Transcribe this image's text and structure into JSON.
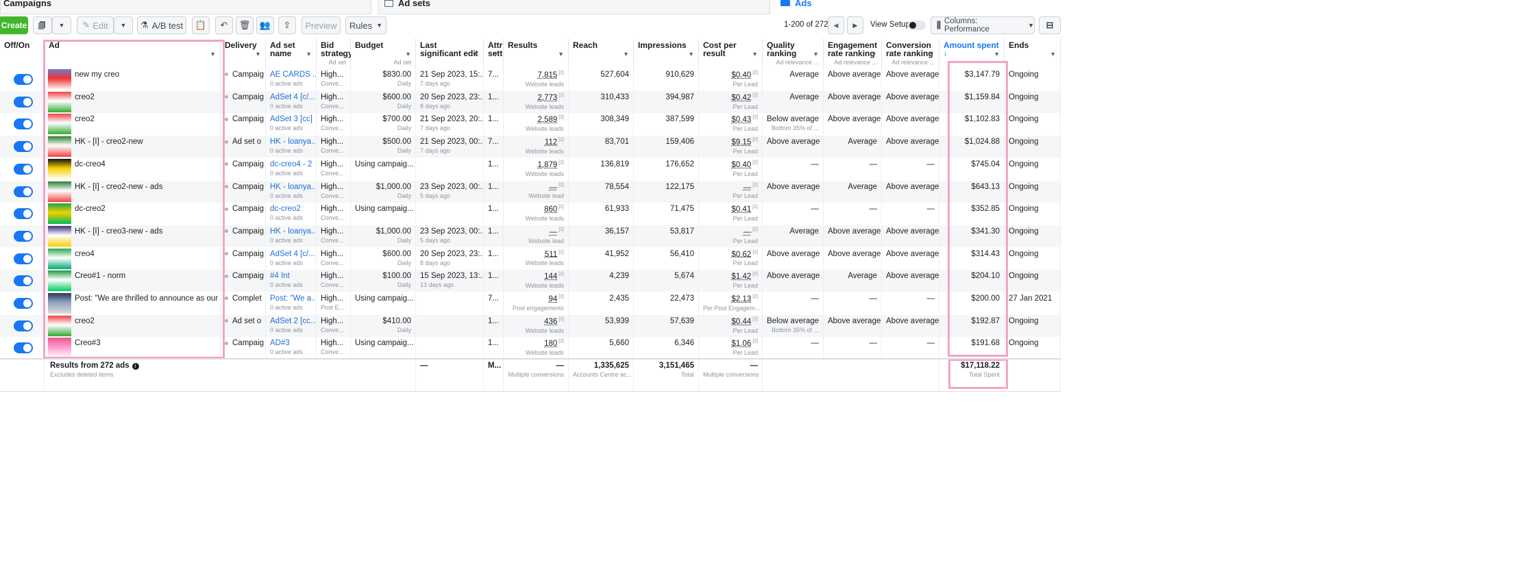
{
  "tabs": {
    "campaigns": "Campaigns",
    "adsets": "Ad sets",
    "ads": "Ads"
  },
  "toolbar": {
    "create": "Create",
    "edit": "Edit",
    "ab_test": "A/B test",
    "preview": "Preview",
    "rules": "Rules",
    "pagination": "1-200 of 272",
    "view_setup": "View Setup",
    "columns": "Columns: Performance"
  },
  "headers": {
    "offon": "Off/On",
    "ad": "Ad",
    "delivery": "Delivery",
    "adset_name": "Ad set name",
    "bid": "Bid strategy",
    "bid_sub": "Ad set",
    "budget": "Budget",
    "budget_sub": "Ad set",
    "last_edit": "Last significant edit",
    "attr": "Attr sett",
    "results": "Results",
    "reach": "Reach",
    "impressions": "Impressions",
    "cpr": "Cost per result",
    "quality": "Quality ranking",
    "quality_sub": "Ad relevance ...",
    "engagement": "Engagement rate ranking",
    "engagement_sub": "Ad relevance ...",
    "conversion": "Conversion rate ranking",
    "conversion_sub": "Ad relevance ...",
    "amount": "Amount spent",
    "amount_sort": "↓",
    "ends": "Ends"
  },
  "rows": [
    {
      "ad": "new my creo",
      "delivery": "Campaig",
      "adset": "AE CARDS ...",
      "adset_sub": "0 active ads",
      "bid": "High...",
      "bid_sub": "Conve...",
      "budget": "$830.00",
      "budget_sub": "Daily",
      "edit": "21 Sep 2023, 15:...",
      "edit_sub": "7 days ago",
      "attr": "7...",
      "results": "7,815",
      "results_sub": "Website leads",
      "reach": "527,604",
      "impr": "910,629",
      "cpr": "$0.40",
      "cpr_sub": "Per Lead",
      "quality": "Average",
      "quality_sub": "",
      "eng": "Above average",
      "conv": "Above average",
      "amount": "$3,147.79",
      "ends": "Ongoing",
      "thumb": [
        "#6b7fc7",
        "#e33",
        "#fff"
      ]
    },
    {
      "ad": "creo2",
      "delivery": "Campaig",
      "adset": "AdSet 4 [c/...",
      "adset_sub": "0 active ads",
      "bid": "High...",
      "bid_sub": "Conve...",
      "budget": "$600.00",
      "budget_sub": "Daily",
      "edit": "20 Sep 2023, 23:...",
      "edit_sub": "8 days ago",
      "attr": "1...",
      "results": "2,773",
      "results_sub": "Website leads",
      "reach": "310,433",
      "impr": "394,987",
      "cpr": "$0.42",
      "cpr_sub": "Per Lead",
      "quality": "Average",
      "quality_sub": "",
      "eng": "Above average",
      "conv": "Above average",
      "amount": "$1,159.84",
      "ends": "Ongoing",
      "thumb": [
        "#e44",
        "#fff",
        "#3a3"
      ]
    },
    {
      "ad": "creo2",
      "delivery": "Campaig",
      "adset": "AdSet 3 [cc]",
      "adset_sub": "0 active ads",
      "bid": "High...",
      "bid_sub": "Conve...",
      "budget": "$700.00",
      "budget_sub": "Daily",
      "edit": "21 Sep 2023, 20:...",
      "edit_sub": "7 days ago",
      "attr": "1...",
      "results": "2,589",
      "results_sub": "Website leads",
      "reach": "308,349",
      "impr": "387,599",
      "cpr": "$0.43",
      "cpr_sub": "Per Lead",
      "quality": "Below average",
      "quality_sub": "Bottom 35% of ...",
      "eng": "Above average",
      "conv": "Above average",
      "amount": "$1,102.83",
      "ends": "Ongoing",
      "thumb": [
        "#e44",
        "#fff",
        "#3a3"
      ]
    },
    {
      "ad": "HK - [I] - creo2-new",
      "delivery": "Ad set o",
      "adset": "HK - loanya...",
      "adset_sub": "0 active ads",
      "bid": "High...",
      "bid_sub": "Conve...",
      "budget": "$500.00",
      "budget_sub": "Daily",
      "edit": "21 Sep 2023, 00:...",
      "edit_sub": "7 days ago",
      "attr": "7...",
      "results": "112",
      "results_sub": "Website leads",
      "reach": "83,701",
      "impr": "159,406",
      "cpr": "$9.15",
      "cpr_sub": "Per Lead",
      "quality": "Above average",
      "quality_sub": "",
      "eng": "Average",
      "conv": "Above average",
      "amount": "$1,024.88",
      "ends": "Ongoing",
      "thumb": [
        "#2e7d32",
        "#fff",
        "#e44"
      ]
    },
    {
      "ad": "dc-creo4",
      "delivery": "Campaig",
      "adset": "dc-creo4 - 2",
      "adset_sub": "0 active ads",
      "bid": "High...",
      "bid_sub": "Conve...",
      "budget": "Using campaig...",
      "budget_sub": "",
      "edit": "",
      "edit_sub": "",
      "attr": "1...",
      "results": "1,879",
      "results_sub": "Website leads",
      "reach": "136,819",
      "impr": "176,652",
      "cpr": "$0.40",
      "cpr_sub": "Per Lead",
      "quality": "—",
      "quality_sub": "",
      "eng": "—",
      "conv": "—",
      "amount": "$745.04",
      "ends": "Ongoing",
      "thumb": [
        "#111",
        "#f5d000",
        "#fff"
      ]
    },
    {
      "ad": "HK - [I] - creo2-new - ads",
      "delivery": "Campaig",
      "adset": "HK - loanya...",
      "adset_sub": "0 active ads",
      "bid": "High...",
      "bid_sub": "Conve...",
      "budget": "$1,000.00",
      "budget_sub": "Daily",
      "edit": "23 Sep 2023, 00:...",
      "edit_sub": "5 days ago",
      "attr": "1...",
      "results": "—",
      "results_sub": "Website lead",
      "reach": "78,554",
      "impr": "122,175",
      "cpr": "—",
      "cpr_sub": "Per Lead",
      "quality": "Above average",
      "quality_sub": "",
      "eng": "Average",
      "conv": "Above average",
      "amount": "$643.13",
      "ends": "Ongoing",
      "thumb": [
        "#2e7d32",
        "#fff",
        "#e44"
      ]
    },
    {
      "ad": "dc-creo2",
      "delivery": "Campaig",
      "adset": "dc-creo2",
      "adset_sub": "0 active ads",
      "bid": "High...",
      "bid_sub": "Conve...",
      "budget": "Using campaig...",
      "budget_sub": "",
      "edit": "",
      "edit_sub": "",
      "attr": "1...",
      "results": "860",
      "results_sub": "Website leads",
      "reach": "61,933",
      "impr": "71,475",
      "cpr": "$0.41",
      "cpr_sub": "Per Lead",
      "quality": "—",
      "quality_sub": "",
      "eng": "—",
      "conv": "—",
      "amount": "$352.85",
      "ends": "Ongoing",
      "thumb": [
        "#1fa44a",
        "#f5d000",
        "#0b5"
      ]
    },
    {
      "ad": "HK - [I] - creo3-new - ads",
      "delivery": "Campaig",
      "adset": "HK - loanya...",
      "adset_sub": "0 active ads",
      "bid": "High...",
      "bid_sub": "Conve...",
      "budget": "$1,000.00",
      "budget_sub": "Daily",
      "edit": "23 Sep 2023, 00:...",
      "edit_sub": "5 days ago",
      "attr": "1...",
      "results": "—",
      "results_sub": "Website lead",
      "reach": "36,157",
      "impr": "53,817",
      "cpr": "—",
      "cpr_sub": "Per Lead",
      "quality": "Average",
      "quality_sub": "",
      "eng": "Above average",
      "conv": "Above average",
      "amount": "$341.30",
      "ends": "Ongoing",
      "thumb": [
        "#3b2f7a",
        "#fff",
        "#f5d000"
      ]
    },
    {
      "ad": "creo4",
      "delivery": "Campaig",
      "adset": "AdSet 4 [c/...",
      "adset_sub": "0 active ads",
      "bid": "High...",
      "bid_sub": "Conve...",
      "budget": "$600.00",
      "budget_sub": "Daily",
      "edit": "20 Sep 2023, 23:...",
      "edit_sub": "8 days ago",
      "attr": "1...",
      "results": "511",
      "results_sub": "Website leads",
      "reach": "41,952",
      "impr": "56,410",
      "cpr": "$0.62",
      "cpr_sub": "Per Lead",
      "quality": "Above average",
      "quality_sub": "",
      "eng": "Above average",
      "conv": "Above average",
      "amount": "$314.43",
      "ends": "Ongoing",
      "thumb": [
        "#2aa84a",
        "#fff",
        "#0a7"
      ]
    },
    {
      "ad": "Creo#1 - norm",
      "delivery": "Campaig",
      "adset": "#4 Int",
      "adset_sub": "0 active ads",
      "bid": "High...",
      "bid_sub": "Conve...",
      "budget": "$100.00",
      "budget_sub": "Daily",
      "edit": "15 Sep 2023, 13:...",
      "edit_sub": "13 days ago",
      "attr": "1...",
      "results": "144",
      "results_sub": "Website leads",
      "reach": "4,239",
      "impr": "5,674",
      "cpr": "$1.42",
      "cpr_sub": "Per Lead",
      "quality": "Above average",
      "quality_sub": "",
      "eng": "Average",
      "conv": "Above average",
      "amount": "$204.10",
      "ends": "Ongoing",
      "thumb": [
        "#1f9a3e",
        "#fff",
        "#0c6"
      ]
    },
    {
      "ad": "Post: \"We are thrilled to announce as our ne...",
      "delivery": "Complet",
      "adset": "Post: \"We a...",
      "adset_sub": "0 active ads",
      "bid": "High...",
      "bid_sub": "Post E...",
      "budget": "Using campaig...",
      "budget_sub": "",
      "edit": "",
      "edit_sub": "",
      "attr": "7...",
      "results": "94",
      "results_sub": "Post engagements",
      "reach": "2,435",
      "impr": "22,473",
      "cpr": "$2.13",
      "cpr_sub": "Per Post Engagem...",
      "quality": "—",
      "quality_sub": "",
      "eng": "—",
      "conv": "—",
      "amount": "$200.00",
      "ends": "27 Jan 2021",
      "thumb": [
        "#2a3a55",
        "#8fa3c0",
        "#ddd"
      ]
    },
    {
      "ad": "creo2",
      "delivery": "Ad set o",
      "adset": "AdSet 2 [cc...",
      "adset_sub": "0 active ads",
      "bid": "High...",
      "bid_sub": "Conve...",
      "budget": "$410.00",
      "budget_sub": "Daily",
      "edit": "",
      "edit_sub": "",
      "attr": "1...",
      "results": "436",
      "results_sub": "Website leads",
      "reach": "53,939",
      "impr": "57,639",
      "cpr": "$0.44",
      "cpr_sub": "Per Lead",
      "quality": "Below average",
      "quality_sub": "Bottom 35% of ...",
      "eng": "Above average",
      "conv": "Above average",
      "amount": "$192.87",
      "ends": "Ongoing",
      "thumb": [
        "#e44",
        "#fff",
        "#3a3"
      ]
    },
    {
      "ad": "Creo#3",
      "delivery": "Campaig",
      "adset": "AD#3",
      "adset_sub": "0 active ads",
      "bid": "High...",
      "bid_sub": "Conve...",
      "budget": "Using campaig...",
      "budget_sub": "",
      "edit": "",
      "edit_sub": "",
      "attr": "1...",
      "results": "180",
      "results_sub": "Website leads",
      "reach": "5,660",
      "impr": "6,346",
      "cpr": "$1.06",
      "cpr_sub": "Per Lead",
      "quality": "—",
      "quality_sub": "",
      "eng": "—",
      "conv": "—",
      "amount": "$191.68",
      "ends": "Ongoing",
      "thumb": [
        "#e85a8a",
        "#f9c",
        "#fff"
      ]
    }
  ],
  "summary": {
    "label": "Results from 272 ads",
    "label_sub": "Excludes deleted items",
    "edit": "—",
    "attr": "M...",
    "results": "—",
    "results_sub": "Multiple conversions",
    "reach": "1,335,625",
    "reach_sub": "Accounts Centre ac...",
    "impr": "3,151,465",
    "impr_sub": "Total",
    "cpr": "—",
    "cpr_sub": "Multiple conversions",
    "amount": "$17,118.22",
    "amount_sub": "Total Spent"
  },
  "colors": {
    "accent": "#1877f2",
    "create": "#42b72a",
    "highlight": "#f5a3c7",
    "link": "#216fdb"
  }
}
